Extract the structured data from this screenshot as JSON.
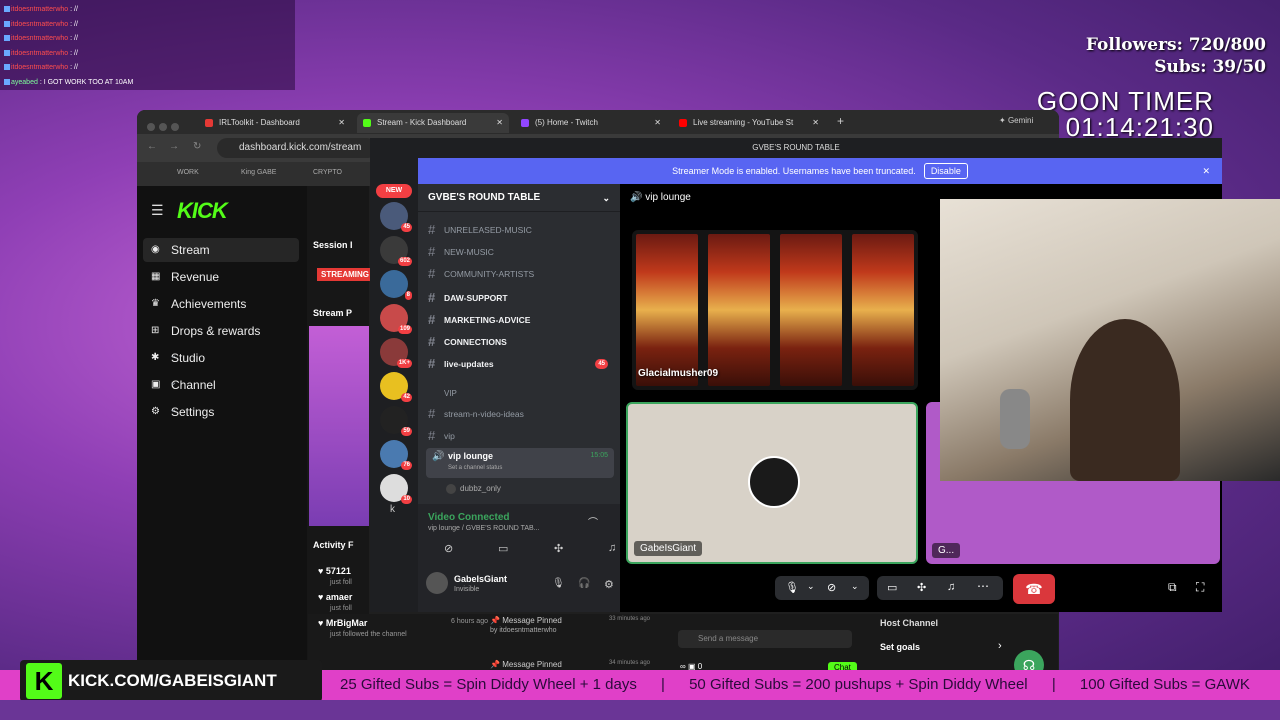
{
  "chat": {
    "lines": [
      {
        "user": "itdoesntmatterwho",
        "msg": ": //"
      },
      {
        "user": "itdoesntmatterwho",
        "msg": ": //"
      },
      {
        "user": "itdoesntmatterwho",
        "msg": ": //"
      },
      {
        "user": "itdoesntmatterwho",
        "msg": ": //"
      },
      {
        "user": "itdoesntmatterwho",
        "msg": ": //"
      },
      {
        "user": "ayeabed",
        "msg": ": I GOT WORK TOO AT 10AM"
      }
    ]
  },
  "goals": {
    "followers": "Followers: 720/800",
    "subs": "Subs: 39/50"
  },
  "timer": {
    "label": "GOON TIMER",
    "value": "01:14:21:30"
  },
  "ticker": {
    "items": [
      "25 Gifted Subs = Spin Diddy Wheel + 1 days",
      "|",
      "50 Gifted Subs = 200 pushups + Spin Diddy Wheel",
      "|",
      "100 Gifted Subs = GAWK"
    ]
  },
  "kick_url": "KICK.COM/GABEISGIANT",
  "browser": {
    "tabs": [
      {
        "label": "IRLToolkit - Dashboard"
      },
      {
        "label": "Stream - Kick Dashboard"
      },
      {
        "label": "(5) Home - Twitch"
      },
      {
        "label": "Live streaming - YouTube St"
      }
    ],
    "gemini": "Gemini",
    "url": "dashboard.kick.com/stream",
    "bookmarks": [
      "WORK",
      "King GABE",
      "CRYPTO"
    ]
  },
  "kick": {
    "logo": "KICK",
    "nav": [
      {
        "label": "Stream",
        "icon": "stream-icon"
      },
      {
        "label": "Revenue",
        "icon": "revenue-icon"
      },
      {
        "label": "Achievements",
        "icon": "trophy-icon"
      },
      {
        "label": "Drops & rewards",
        "icon": "gift-icon"
      },
      {
        "label": "Studio",
        "icon": "studio-icon"
      },
      {
        "label": "Channel",
        "icon": "channel-icon"
      },
      {
        "label": "Settings",
        "icon": "gear-icon"
      }
    ],
    "session": "Session I",
    "streaming": "STREAMING",
    "stream_p": "Stream P",
    "activity": "Activity F",
    "feed": [
      {
        "name": "57121",
        "sub": "just foll"
      },
      {
        "name": "amaer",
        "sub": "just foll"
      },
      {
        "name": "MrBigMar",
        "sub": "just followed the channel",
        "time": "6 hours ago"
      }
    ],
    "pinned": [
      {
        "title": "Message Pinned",
        "by": "by itdoesntmatterwho",
        "time": "33 minutes ago"
      },
      {
        "title": "Message Pinned",
        "time": "34 minutes ago"
      }
    ],
    "send_placeholder": "Send a message",
    "chat_btn": "Chat",
    "host": "Host Channel",
    "set_goals": "Set goals",
    "counts": [
      "0"
    ]
  },
  "discord": {
    "title": "GVBE'S ROUND TABLE",
    "banner": "Streamer Mode is enabled. Usernames have been truncated.",
    "disable": "Disable",
    "new_label": "NEW",
    "server_badges": [
      "45",
      "602",
      "8",
      "109",
      "1K+",
      "42",
      "59",
      "76",
      "10"
    ],
    "server_letter": "k",
    "server": "GVBE'S ROUND TABLE",
    "channels": [
      {
        "name": "UNRELEASED-MUSIC",
        "bold": false
      },
      {
        "name": "NEW-MUSIC",
        "bold": false
      },
      {
        "name": "COMMUNITY-ARTISTS",
        "bold": false
      },
      {
        "name": "DAW-SUPPORT",
        "bold": true
      },
      {
        "name": "MARKETING-ADVICE",
        "bold": true
      },
      {
        "name": "CONNECTIONS",
        "bold": true
      },
      {
        "name": "live-updates",
        "bold": true,
        "count": "45"
      }
    ],
    "vip_cat": "VIP",
    "vip_channels": [
      "stream-n-video-ideas",
      "vip"
    ],
    "voice": {
      "name": "vip lounge",
      "status": "Set a channel status",
      "time": "15:05",
      "member": "dubbz_only"
    },
    "video_connected": "Video Connected",
    "video_sub": "vip lounge / GVBE'S ROUND TAB...",
    "user": {
      "name": "GabeIsGiant",
      "status": "Invisible"
    },
    "stage_title": "vip lounge",
    "tiles": [
      {
        "name": "Glacialmusher09"
      },
      {
        "name": "GabeIsGiant"
      },
      {
        "name": "G..."
      }
    ]
  },
  "colors": {
    "kick_green": "#53fc18",
    "discord_blurple": "#5865f2",
    "hangup_red": "#da373c"
  }
}
